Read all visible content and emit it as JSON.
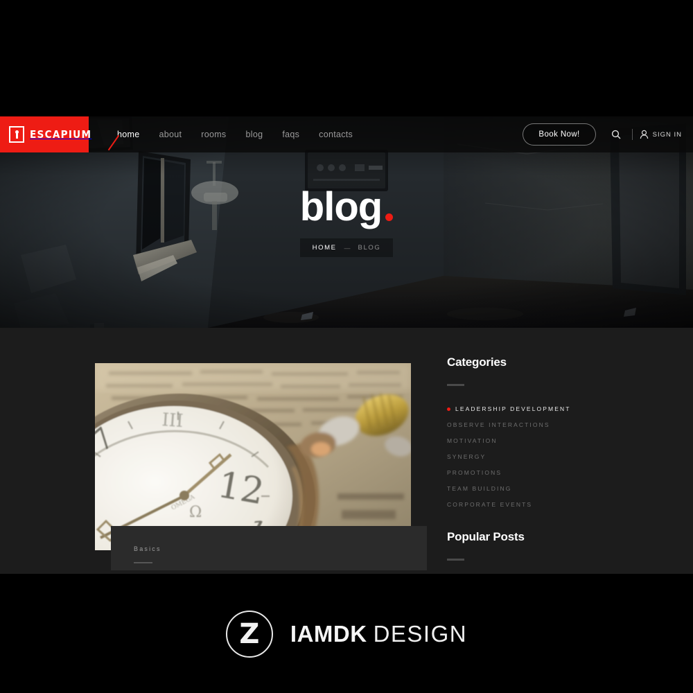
{
  "header": {
    "logo": {
      "text": "ESCAPIUM",
      "icon": "keyhole-icon",
      "bg": "#ee1c14"
    },
    "nav": [
      {
        "label": "home",
        "active": true
      },
      {
        "label": "about",
        "active": false
      },
      {
        "label": "rooms",
        "active": false
      },
      {
        "label": "blog",
        "active": false
      },
      {
        "label": "faqs",
        "active": false
      },
      {
        "label": "contacts",
        "active": false
      }
    ],
    "book_button": "Book Now!",
    "search_icon": "search-icon",
    "signin_icon": "user-icon",
    "signin_label": "SIGN IN"
  },
  "hero": {
    "title": "blog",
    "accent_color": "#ee1c14",
    "breadcrumb": [
      {
        "label": "HOME",
        "current": false
      },
      {
        "label": "BLOG",
        "current": true
      }
    ],
    "separator": "—"
  },
  "post": {
    "image_alt": "vintage-pocket-watch-on-newspaper",
    "category": "Basics"
  },
  "sidebar": {
    "categories_heading": "Categories",
    "categories": [
      {
        "label": "LEADERSHIP DEVELOPMENT",
        "active": true
      },
      {
        "label": "OBSERVE INTERACTIONS",
        "active": false
      },
      {
        "label": "MOTIVATION",
        "active": false
      },
      {
        "label": "SYNERGY",
        "active": false
      },
      {
        "label": "PROMOTIONS",
        "active": false
      },
      {
        "label": "TEAM BUILDING",
        "active": false
      },
      {
        "label": "CORPORATE EVENTS",
        "active": false
      }
    ],
    "popular_heading": "Popular Posts"
  },
  "watermark": {
    "mark": "Z",
    "name_bold": "IAMDK",
    "name_light": "DESIGN"
  }
}
